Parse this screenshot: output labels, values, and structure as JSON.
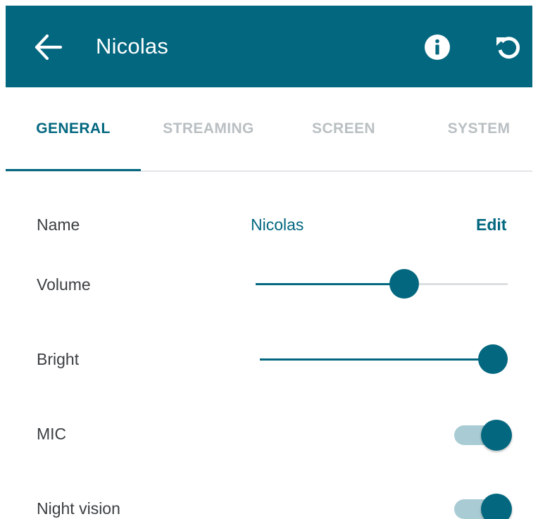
{
  "app_bar": {
    "title": "Nicolas",
    "back_icon": "arrow-left-icon",
    "info_icon": "info-icon",
    "reset_icon": "reset-icon"
  },
  "tabs": [
    {
      "label": "GENERAL",
      "active": true
    },
    {
      "label": "STREAMING",
      "active": false
    },
    {
      "label": "SCREEN",
      "active": false
    },
    {
      "label": "SYSTEM",
      "active": false
    }
  ],
  "settings": {
    "name": {
      "label": "Name",
      "value": "Nicolas",
      "edit_label": "Edit"
    },
    "volume": {
      "label": "Volume",
      "level": 0.59
    },
    "bright": {
      "label": "Bright",
      "level": 1.0
    },
    "mic": {
      "label": "MIC",
      "on": true
    },
    "night_vision": {
      "label": "Night vision",
      "on": true
    }
  },
  "colors": {
    "primary": "#02677f",
    "toggle_track": "#a9ccd4",
    "inactive_tab": "#b9bfc2",
    "divider": "#e2e5e6"
  }
}
